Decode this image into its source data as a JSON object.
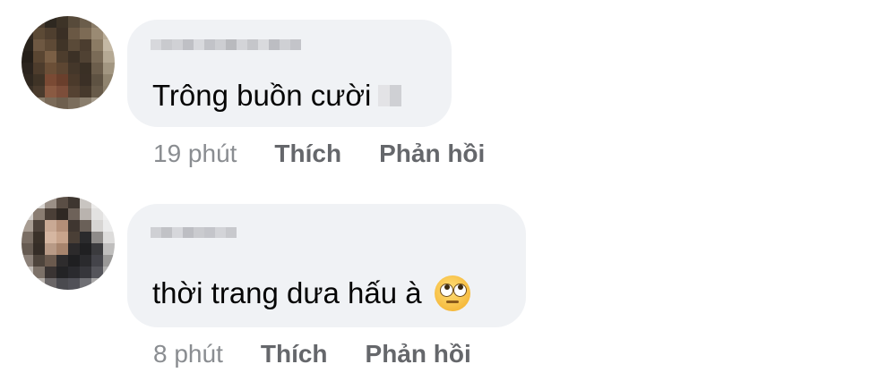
{
  "comments": [
    {
      "author_name": "",
      "text": "Trông buồn cười",
      "time": "19 phút",
      "like_label": "Thích",
      "reply_label": "Phản hồi"
    },
    {
      "author_name": "",
      "text": "thời trang dưa hấu à",
      "time": "8 phút",
      "like_label": "Thích",
      "reply_label": "Phản hồi",
      "emoji": "face-with-rolling-eyes-icon"
    }
  ],
  "colors": {
    "bubble": "#f0f2f5",
    "text": "#050505",
    "meta": "#65676b"
  }
}
